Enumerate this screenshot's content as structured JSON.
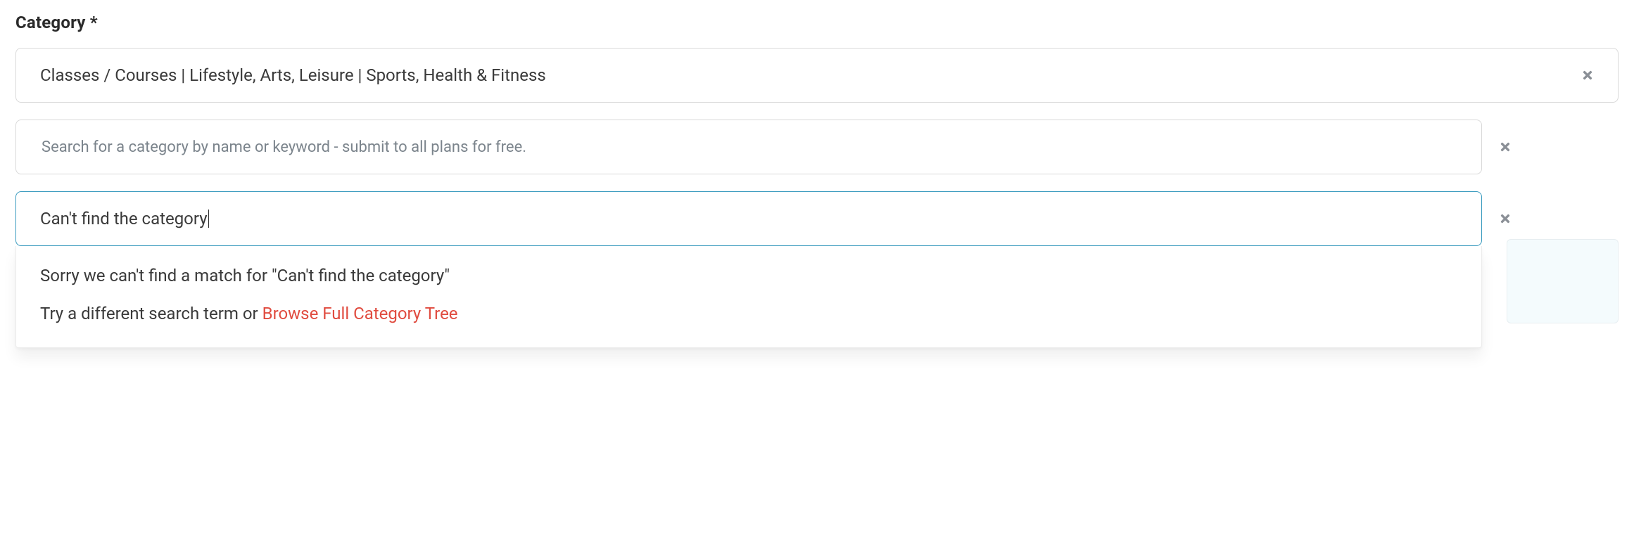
{
  "field": {
    "label": "Category *"
  },
  "selected": {
    "value": "Classes / Courses | Lifestyle, Arts, Leisure | Sports, Health & Fitness"
  },
  "search1": {
    "placeholder": "Search for a category by name or keyword - submit to all plans for free.",
    "value": ""
  },
  "search2": {
    "value": "Can't find the category",
    "placeholder": ""
  },
  "dropdown": {
    "no_match": "Sorry we can't find a match for \"Can't find the category\"",
    "try_prefix": "Try a different search term or ",
    "browse_link": "Browse Full Category Tree"
  },
  "icons": {
    "clear": "close-icon"
  }
}
